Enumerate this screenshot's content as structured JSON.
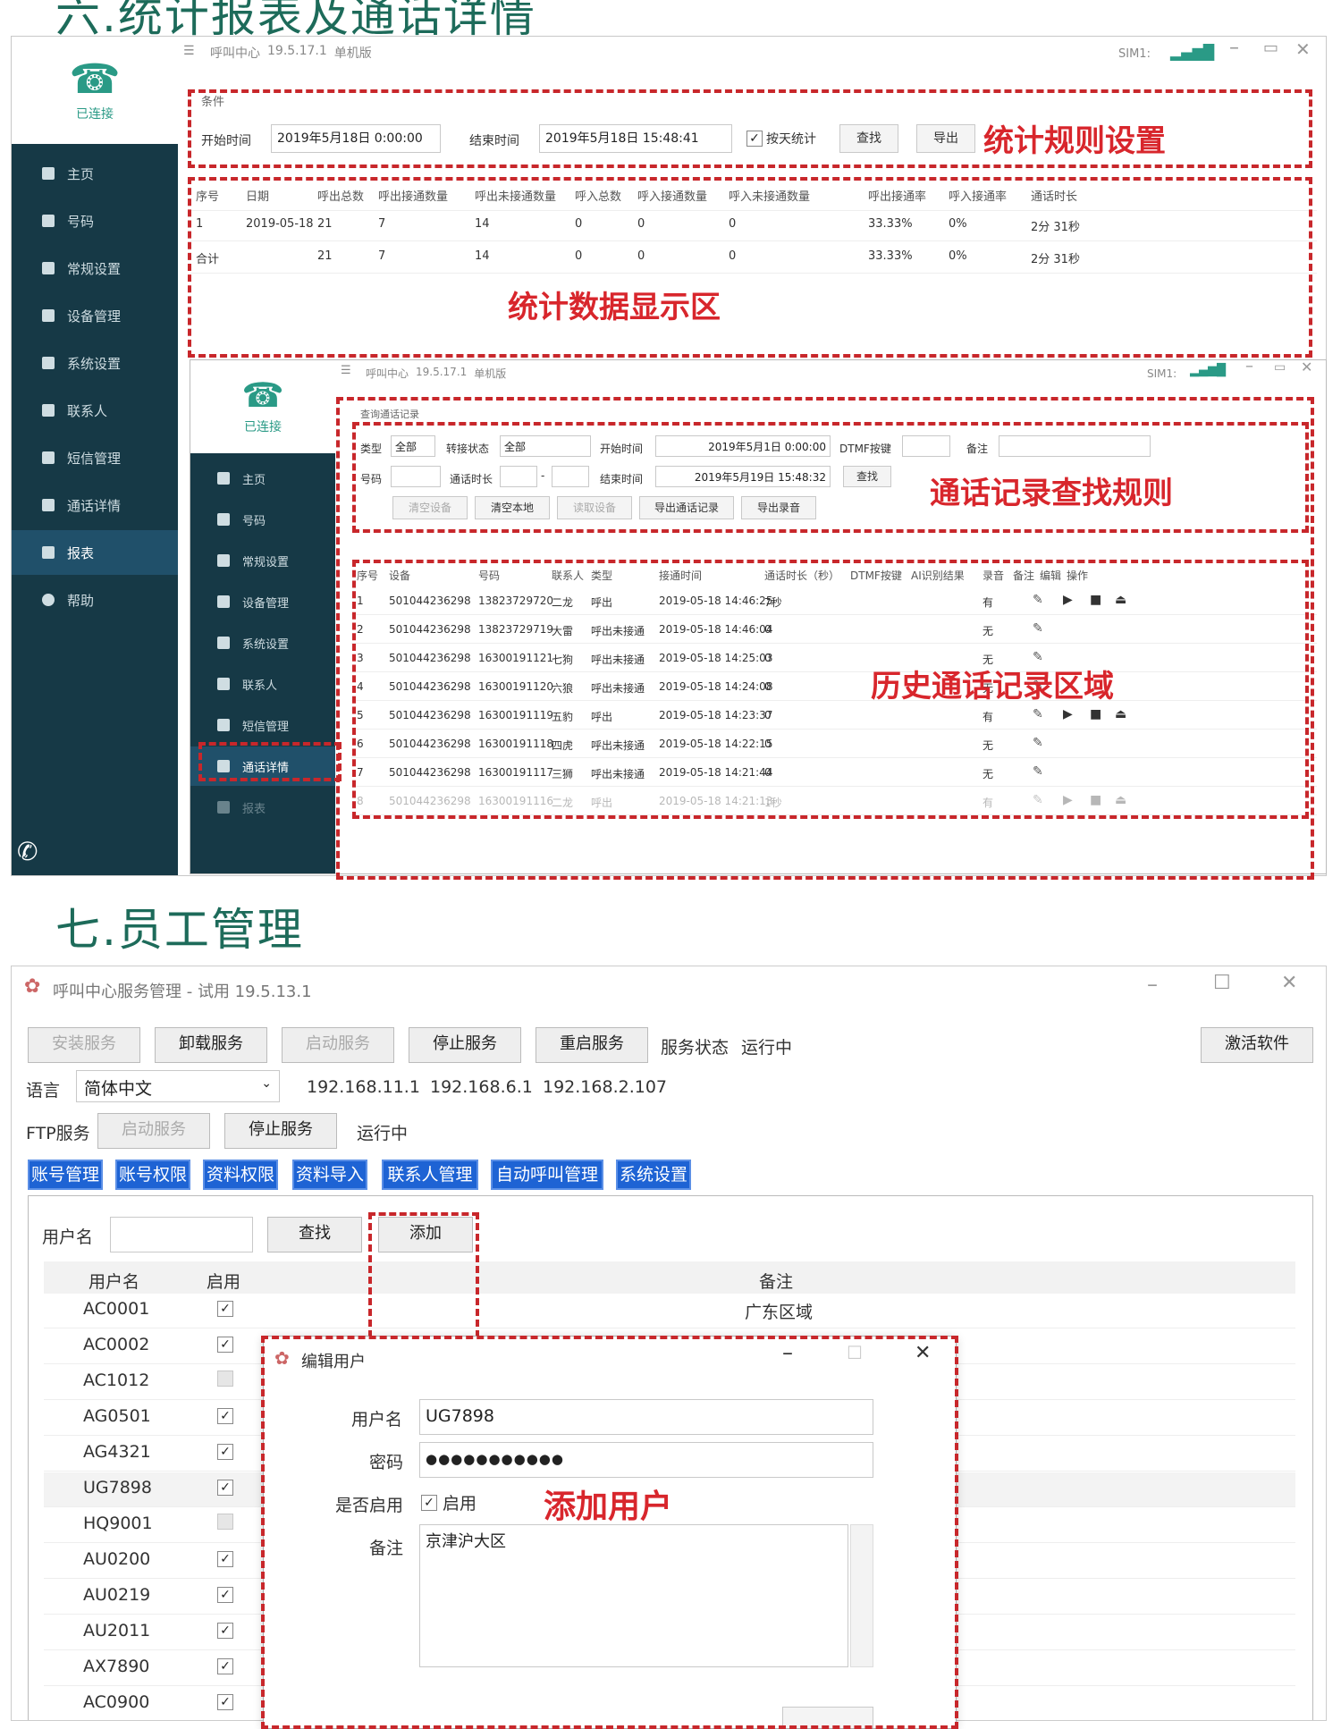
{
  "section6": {
    "title": "六.统计报表及通话详情"
  },
  "section7": {
    "title": "七.员工管理"
  },
  "app": {
    "name": "呼叫中心",
    "version": "19.5.17.1",
    "edition": "单机版",
    "connected": "已连接",
    "sim_label": "SIM1:"
  },
  "sidebar": {
    "items": [
      {
        "label": "主页"
      },
      {
        "label": "号码"
      },
      {
        "label": "常规设置"
      },
      {
        "label": "设备管理"
      },
      {
        "label": "系统设置"
      },
      {
        "label": "联系人"
      },
      {
        "label": "短信管理"
      },
      {
        "label": "通话详情"
      },
      {
        "label": "报表"
      },
      {
        "label": "帮助"
      }
    ],
    "active_top": "报表",
    "active_inner": "通话详情"
  },
  "stats": {
    "conditions_label": "条件",
    "start_label": "开始时间",
    "start_value": "2019年5月18日 0:00:00",
    "end_label": "结束时间",
    "end_value": "2019年5月18日 15:48:41",
    "by_day_label": "按天统计",
    "search": "查找",
    "export": "导出",
    "rule_annotation": "统计规则设置",
    "data_annotation": "统计数据显示区",
    "headers": [
      "序号",
      "日期",
      "呼出总数",
      "呼出接通数量",
      "呼出未接通数量",
      "呼入总数",
      "呼入接通数量",
      "呼入未接通数量",
      "呼出接通率",
      "呼入接通率",
      "通话时长"
    ],
    "rows": [
      [
        "1",
        "2019-05-18",
        "21",
        "7",
        "14",
        "0",
        "0",
        "0",
        "33.33%",
        "0%",
        "2分 31秒"
      ],
      [
        "合计",
        "",
        "21",
        "7",
        "14",
        "0",
        "0",
        "0",
        "33.33%",
        "0%",
        "2分 31秒"
      ]
    ]
  },
  "calls": {
    "group_label": "查询通话记录",
    "type_label": "类型",
    "type_value": "全部",
    "transfer_label": "转接状态",
    "transfer_value": "全部",
    "start_label": "开始时间",
    "start_value": "2019年5月1日 0:00:00",
    "dtmf_label": "DTMF按键",
    "note_label": "备注",
    "number_label": "号码",
    "duration_label": "通话时长",
    "end_label": "结束时间",
    "end_value": "2019年5月19日 15:48:32",
    "search": "查找",
    "buttons": [
      "清空设备",
      "清空本地",
      "读取设备",
      "导出通话记录",
      "导出录音"
    ],
    "rule_annotation": "通话记录查找规则",
    "history_annotation": "历史通话记录区域",
    "headers": [
      "序号",
      "设备",
      "号码",
      "联系人",
      "类型",
      "接通时间",
      "通话时长（秒）",
      "DTMF按键",
      "AI识别结果",
      "录音",
      "备注",
      "编辑",
      "操作"
    ],
    "rows": [
      [
        "1",
        "501044236298",
        "13823729720",
        "二龙",
        "呼出",
        "2019-05-18 14:46:25",
        "7秒",
        "有"
      ],
      [
        "2",
        "501044236298",
        "13823729719",
        "大雷",
        "呼出未接通",
        "2019-05-18 14:46:04",
        "0",
        "无"
      ],
      [
        "3",
        "501044236298",
        "16300191121",
        "七狗",
        "呼出未接通",
        "2019-05-18 14:25:03",
        "0",
        "无"
      ],
      [
        "4",
        "501044236298",
        "16300191120",
        "六狼",
        "呼出未接通",
        "2019-05-18 14:24:08",
        "0",
        "无"
      ],
      [
        "5",
        "501044236298",
        "16300191119",
        "五豹",
        "呼出",
        "2019-05-18 14:23:37",
        "0",
        "有"
      ],
      [
        "6",
        "501044236298",
        "16300191118",
        "四虎",
        "呼出未接通",
        "2019-05-18 14:22:15",
        "0",
        "无"
      ],
      [
        "7",
        "501044236298",
        "16300191117",
        "三狮",
        "呼出未接通",
        "2019-05-18 14:21:44",
        "0",
        "无"
      ],
      [
        "8",
        "501044236298",
        "16300191116",
        "二龙",
        "呼出",
        "2019-05-18 14:21:13",
        "1秒",
        "有"
      ]
    ]
  },
  "mgmt": {
    "window_title": "呼叫中心服务管理 - 试用 19.5.13.1",
    "service_buttons": [
      "安装服务",
      "卸载服务",
      "启动服务",
      "停止服务",
      "重启服务"
    ],
    "service_status_label": "服务状态",
    "service_status_value": "运行中",
    "activate": "激活软件",
    "language_label": "语言",
    "language_value": "简体中文",
    "ips": [
      "192.168.11.1",
      "192.168.6.1",
      "192.168.2.107"
    ],
    "ftp_label": "FTP服务",
    "ftp_start": "启动服务",
    "ftp_stop": "停止服务",
    "ftp_status": "运行中",
    "tabs": [
      "账号管理",
      "账号权限",
      "资料权限",
      "资料导入",
      "联系人管理",
      "自动呼叫管理",
      "系统设置"
    ],
    "username_label": "用户名",
    "search": "查找",
    "add": "添加",
    "col_username": "用户名",
    "col_enabled": "启用",
    "col_note": "备注",
    "users": [
      {
        "name": "AC0001",
        "enabled": "✓",
        "note": "广东区域"
      },
      {
        "name": "AC0002",
        "enabled": "✓",
        "note": ""
      },
      {
        "name": "AC1012",
        "enabled": "",
        "note": ""
      },
      {
        "name": "AG0501",
        "enabled": "✓",
        "note": ""
      },
      {
        "name": "AG4321",
        "enabled": "✓",
        "note": ""
      },
      {
        "name": "UG7898",
        "enabled": "✓",
        "note": ""
      },
      {
        "name": "HQ9001",
        "enabled": "",
        "note": ""
      },
      {
        "name": "AU0200",
        "enabled": "✓",
        "note": ""
      },
      {
        "name": "AU0219",
        "enabled": "✓",
        "note": ""
      },
      {
        "name": "AU2011",
        "enabled": "✓",
        "note": ""
      },
      {
        "name": "AX7890",
        "enabled": "✓",
        "note": ""
      },
      {
        "name": "AC0900",
        "enabled": "✓",
        "note": ""
      }
    ]
  },
  "dialog": {
    "title": "编辑用户",
    "username_label": "用户名",
    "username_value": "UG7898",
    "password_label": "密码",
    "password_value": "●●●●●●●●●●●",
    "enabled_question": "是否启用",
    "enabled_label": "启用",
    "note_label": "备注",
    "note_value": "京津沪大区",
    "annotation": "添加用户"
  },
  "colors": {
    "sidebar": "#163946",
    "accent": "#2a9a86",
    "annotation": "#d8262c",
    "tab": "#1e63d4"
  }
}
